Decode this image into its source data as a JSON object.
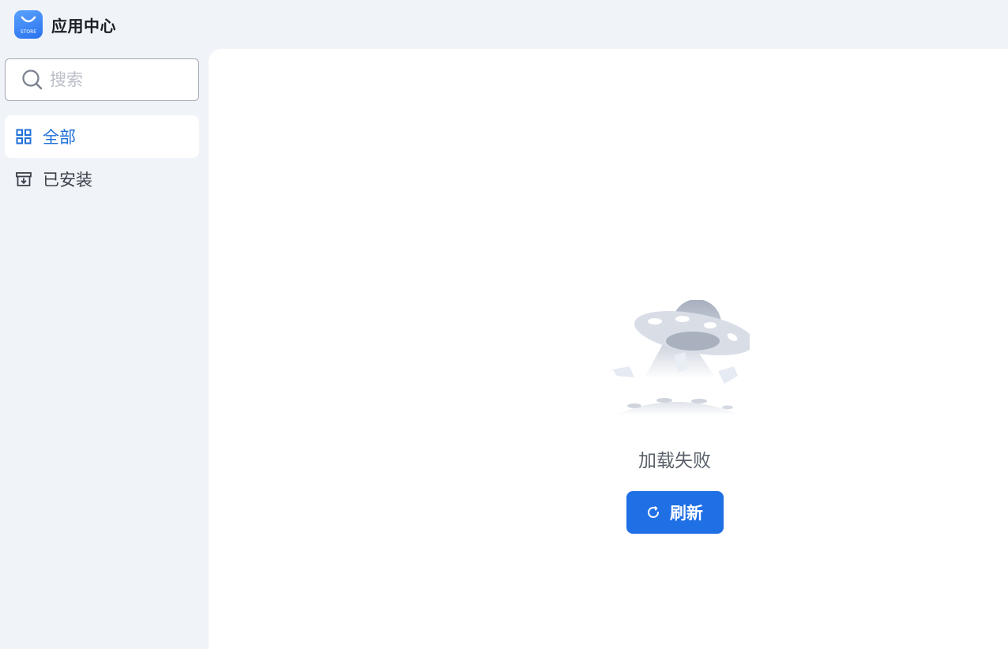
{
  "header": {
    "title": "应用中心",
    "logo_icon": "store-bag-icon",
    "logo_text": "STORE"
  },
  "sidebar": {
    "search": {
      "placeholder": "搜索",
      "value": "",
      "icon": "search-icon"
    },
    "items": [
      {
        "label": "全部",
        "icon": "grid-icon",
        "active": true
      },
      {
        "label": "已安装",
        "icon": "installed-box-icon",
        "active": false
      }
    ]
  },
  "main": {
    "empty_state": {
      "illustration": "ufo-illustration",
      "message": "加载失败",
      "button_label": "刷新",
      "button_icon": "refresh-icon"
    }
  },
  "colors": {
    "accent": "#1f6fe5",
    "active_text": "#1f6fd8",
    "background": "#f0f3f8",
    "panel": "#ffffff"
  }
}
